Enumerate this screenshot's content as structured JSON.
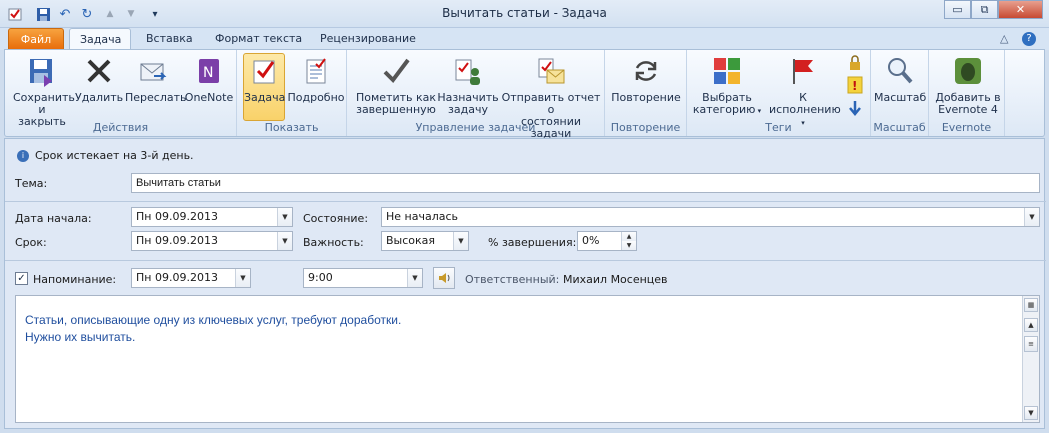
{
  "window": {
    "title": "Вычитать статьи  -  Задача",
    "controls": {
      "minimize": "▭",
      "restore": "⧉",
      "close": "✕"
    }
  },
  "quick_access": {
    "undo": "↶",
    "redo": "↻",
    "up": "▲",
    "down": "▼",
    "customize": "▾"
  },
  "tabs": [
    {
      "label": "Файл"
    },
    {
      "label": "Задача"
    },
    {
      "label": "Вставка"
    },
    {
      "label": "Формат текста"
    },
    {
      "label": "Рецензирование"
    }
  ],
  "ribbon_right": {
    "collapse": "△",
    "help": "?"
  },
  "ribbon": {
    "groups": {
      "actions": "Действия",
      "show": "Показать",
      "manage": "Управление задачей",
      "recurrence": "Повторение",
      "tags": "Теги",
      "zoom": "Масштаб",
      "evernote": "Evernote"
    },
    "buttons": {
      "save_close_1": "Сохранить",
      "save_close_2": "и закрыть",
      "delete": "Удалить",
      "forward": "Переслать",
      "onenote": "OneNote",
      "task": "Задача",
      "details": "Подробно",
      "mark_complete_1": "Пометить как",
      "mark_complete_2": "завершенную",
      "assign_1": "Назначить",
      "assign_2": "задачу",
      "send_report_1": "Отправить отчет о",
      "send_report_2": "состоянии задачи",
      "recurrence": "Повторение",
      "categorize_1": "Выбрать",
      "categorize_2": "категорию",
      "followup_1": "К",
      "followup_2": "исполнению",
      "zoom": "Масштаб",
      "evernote_1": "Добавить в",
      "evernote_2": "Evernote 4"
    }
  },
  "form": {
    "info": "Срок истекает на 3-й день.",
    "subject_label": "Тема:",
    "subject_value": "Вычитать статьи",
    "start_label": "Дата начала:",
    "start_value": "Пн 09.09.2013",
    "due_label": "Срок:",
    "due_value": "Пн 09.09.2013",
    "status_label": "Состояние:",
    "status_value": "Не началась",
    "priority_label": "Важность:",
    "priority_value": "Высокая",
    "complete_label": "% завершения:",
    "complete_value": "0%",
    "reminder_label": "Напоминание:",
    "reminder_date": "Пн 09.09.2013",
    "reminder_time": "9:00",
    "owner_label": "Ответственный:",
    "owner_value": "Михаил Мосенцев",
    "notes_line1": "Статьи, описывающие одну из ключевых услуг, требуют доработки.",
    "notes_line2": "Нужно их вычитать."
  },
  "colors": {
    "file_tab": "#e86d0b",
    "note_text": "#1f4e9e",
    "flag": "#d32020"
  }
}
